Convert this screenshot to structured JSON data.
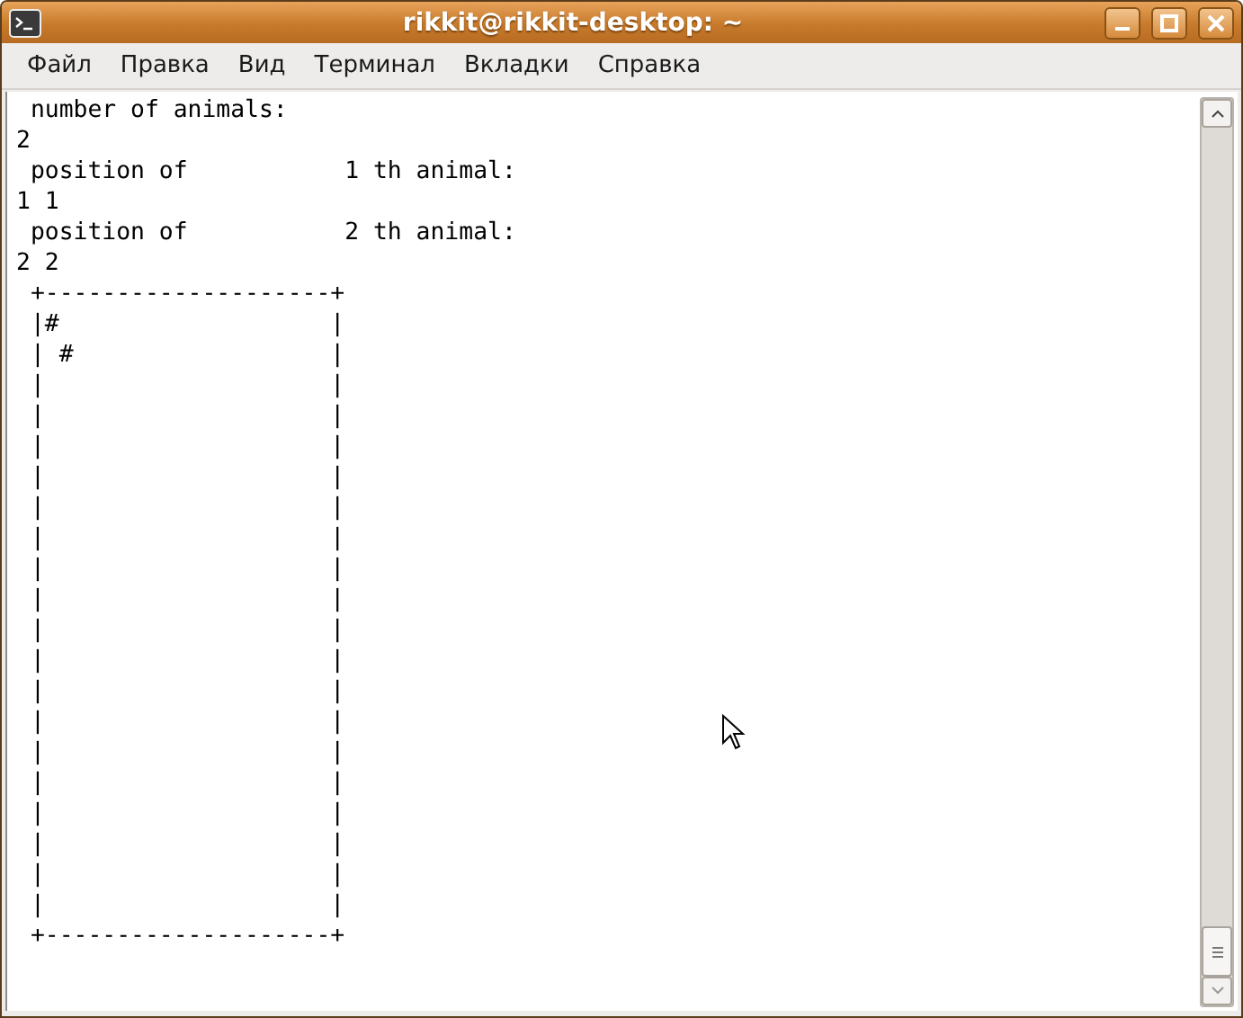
{
  "window": {
    "title": "rikkit@rikkit-desktop: ~"
  },
  "menu": [
    "Файл",
    "Правка",
    "Вид",
    "Терминал",
    "Вкладки",
    "Справка"
  ],
  "terminal": {
    "lines": [
      " number of animals:",
      "2",
      " position of           1 th animal:",
      "1 1",
      " position of           2 th animal:",
      "2 2",
      " +--------------------+",
      " |#                   |",
      " | #                  |",
      " |                    |",
      " |                    |",
      " |                    |",
      " |                    |",
      " |                    |",
      " |                    |",
      " |                    |",
      " |                    |",
      " |                    |",
      " |                    |",
      " |                    |",
      " |                    |",
      " |                    |",
      " |                    |",
      " |                    |",
      " |                    |",
      " |                    |",
      " |                    |",
      " +--------------------+"
    ]
  }
}
